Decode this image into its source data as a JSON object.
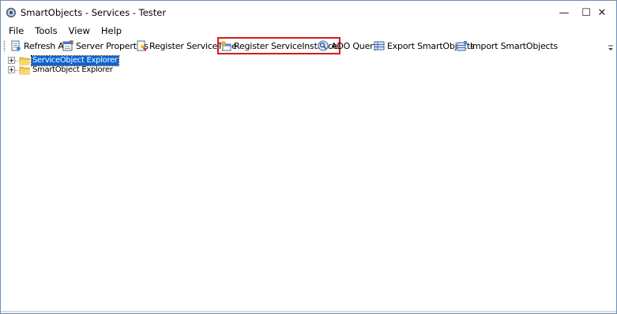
{
  "window": {
    "title": "SmartObjects - Services - Tester"
  },
  "title_controls": {
    "minimize": "—",
    "maximize": "☐",
    "close": "✕"
  },
  "menu": [
    "File",
    "Tools",
    "View",
    "Help"
  ],
  "toolbar": {
    "refresh_all": "Refresh All",
    "server_properties": "Server Properties",
    "register_service_type": "Register ServiceType",
    "register_service_instance": "Register ServiceInstance",
    "ado_query": "ADO Query",
    "export_smartobjects": "Export SmartObjects",
    "import_smartobjects": "Import SmartObjects"
  },
  "tree": {
    "items": [
      {
        "label": "ServiceObject Explorer",
        "selected": true
      },
      {
        "label": "SmartObject Explorer",
        "selected": false
      }
    ]
  },
  "colors": {
    "selection": "#0a64d2",
    "highlight_box": "#d31b1b",
    "window_border": "#6f8fb3"
  }
}
